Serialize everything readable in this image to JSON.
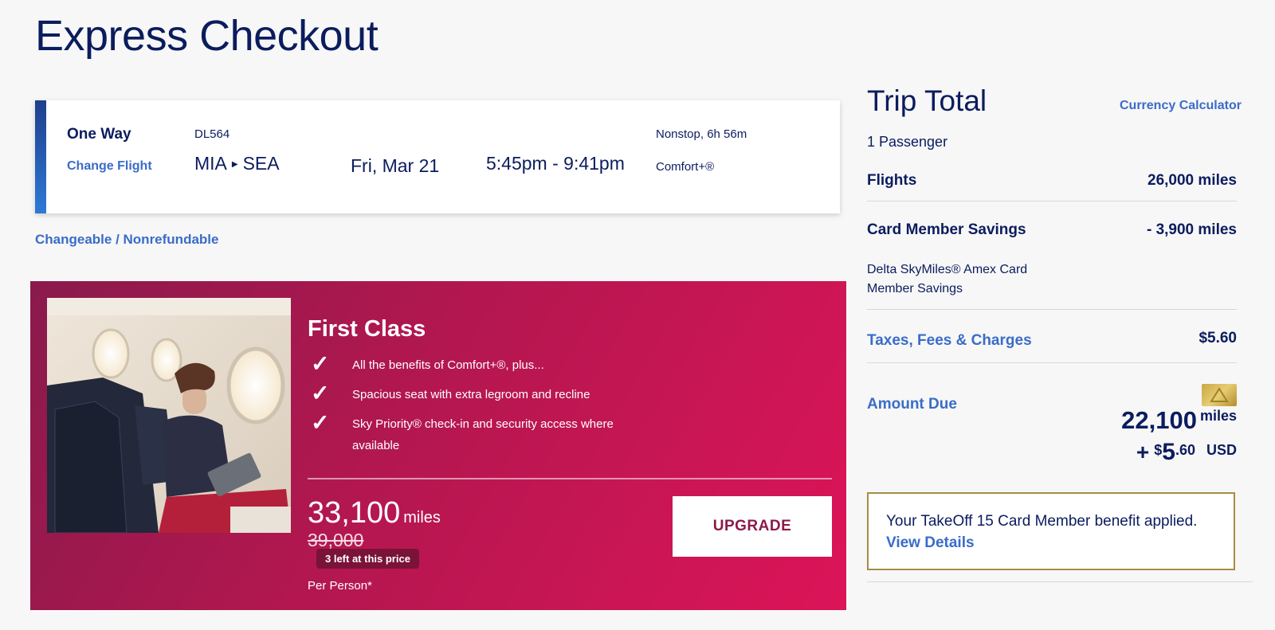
{
  "page": {
    "title": "Express Checkout"
  },
  "flight": {
    "type_label": "One Way",
    "change_label": "Change Flight",
    "flight_number": "DL564",
    "origin": "MIA",
    "destination": "SEA",
    "date": "Fri, Mar 21",
    "times": "5:45pm - 9:41pm",
    "stops_duration": "Nonstop, 6h 56m",
    "cabin": "Comfort+®"
  },
  "fare_rules": "Changeable / Nonrefundable",
  "upgrade": {
    "title": "First Class",
    "benefits": [
      "All the benefits of Comfort+®, plus...",
      "Spacious seat with extra legroom and recline",
      "Sky Priority® check-in and security access where available"
    ],
    "miles": "33,100",
    "miles_unit": "miles",
    "original_miles": "39,000",
    "availability": "3 left at this price",
    "per_person": "Per Person*",
    "button_label": "UPGRADE",
    "check_glyph": "✓"
  },
  "trip_total": {
    "title": "Trip Total",
    "currency_link": "Currency Calculator",
    "passengers": "1 Passenger",
    "flights_label": "Flights",
    "flights_value": "26,000 miles",
    "savings_label": "Card Member Savings",
    "savings_value": "- 3,900 miles",
    "savings_note": "Delta SkyMiles® Amex Card Member Savings",
    "taxes_label": "Taxes, Fees & Charges",
    "taxes_value": "$5.60",
    "amount_due_label": "Amount Due",
    "amount_miles": "22,100",
    "amount_miles_unit": "miles",
    "amount_plus": "+",
    "amount_currency_symbol": "$",
    "amount_whole": "5",
    "amount_cents": ".60",
    "amount_currency": "USD",
    "card_icon": "credit-card-icon"
  },
  "benefit_notice": {
    "text": "Your TakeOff 15 Card Member benefit applied.",
    "link": "View Details"
  },
  "colors": {
    "navy": "#0b1c5e",
    "link_blue": "#3a6cc8",
    "upgrade_gradient_start": "#8a1a4c",
    "upgrade_gradient_end": "#dc1458",
    "gold_border": "#a88c45"
  }
}
